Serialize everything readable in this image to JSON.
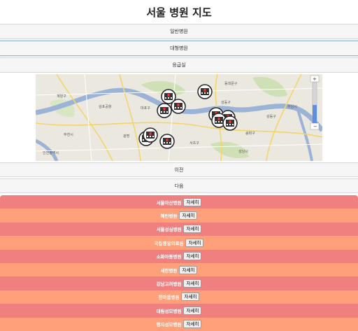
{
  "title": "서울 병원 지도",
  "categories": [
    "일반병원",
    "대형병원",
    "응급실"
  ],
  "map": {
    "labels": [
      "계양구",
      "부천시",
      "인천광역시",
      "광명",
      "하남시",
      "성남시",
      "강동구",
      "송파구",
      "서초구",
      "마포구",
      "성동구",
      "동대문구",
      "김포공항"
    ],
    "hospital_marker_icon": "hospital-building-icon"
  },
  "pager": {
    "prev": "이전",
    "next": "다음"
  },
  "hospitals": [
    {
      "name": "서울아산병원",
      "button": "자세히"
    },
    {
      "name": "혜민병원",
      "button": "자세히"
    },
    {
      "name": "서울성심병원",
      "button": "자세히"
    },
    {
      "name": "국립중앙의료원",
      "button": "자세히"
    },
    {
      "name": "소화아동병원",
      "button": "자세히"
    },
    {
      "name": "세란병원",
      "button": "자세히"
    },
    {
      "name": "강남고려병원",
      "button": "자세히"
    },
    {
      "name": "한마음병원",
      "button": "자세히"
    },
    {
      "name": "대림성모병원",
      "button": "자세히"
    },
    {
      "name": "명지성모병원",
      "button": "자세히"
    }
  ],
  "colors": {
    "row_odd": "#f08080",
    "row_even": "#ffa07a",
    "river": "#9ab3d6",
    "park": "#c9dbb0"
  }
}
